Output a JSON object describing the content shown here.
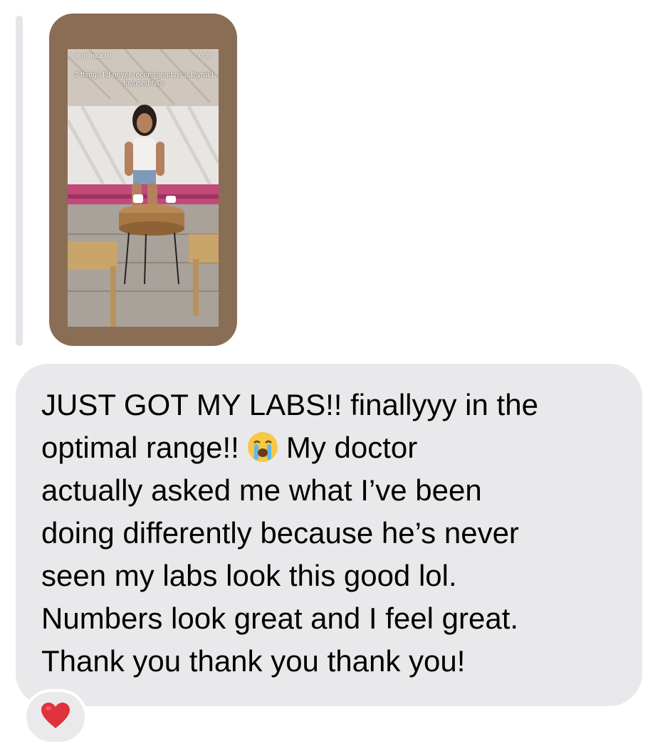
{
  "story_reply": {
    "username": "dr.monica.nd",
    "timestamp": "0:08",
    "caption": "3 things I'd never recommend as a thyroid focused ND:"
  },
  "message": {
    "line1_part": "JUST GOT MY LABS!! finallyyy in the",
    "line2_before": "optimal range!!",
    "line2_emoji": "loudly-crying-face-emoji",
    "line2_after": "My doctor",
    "rest": "actually asked me what I’ve been\ndoing differently because he’s never\nseen my labs look this good lol.\nNumbers look great and I feel great.\nThank you thank you thank you!"
  },
  "reaction": {
    "icon": "red-heart-icon",
    "color": "#e0323c"
  },
  "colors": {
    "bubble": "#e9e9eb",
    "story_frame": "#8a6d55",
    "reply_bar": "#e5e5ea"
  }
}
